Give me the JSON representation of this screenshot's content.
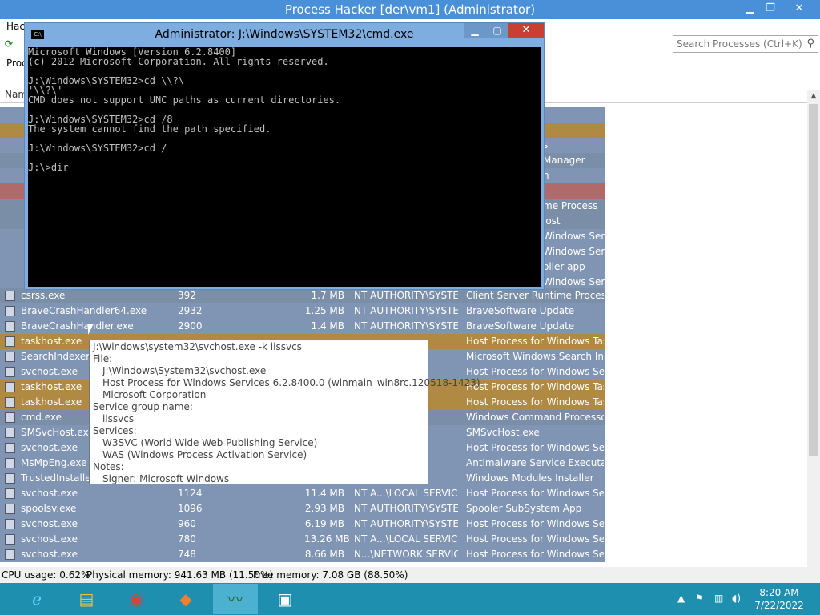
{
  "window": {
    "title": "Process Hacker [der\\vm1] (Administrator)",
    "menu_label": "Hac",
    "processes_tab": "Proc",
    "search_placeholder": "Search Processes (Ctrl+K)",
    "column_name": "Nam",
    "status": {
      "cpu": "CPU usage: 0.62%",
      "physical": "Physical memory: 941.63 MB (11.50%)",
      "free": "Free memory: 7.08 GB (88.50%)"
    }
  },
  "processes_hidden_desc": [
    {
      "row": 3,
      "desc": "s",
      "color": "svc"
    },
    {
      "row": 4,
      "desc": "Manager",
      "color": "sys"
    },
    {
      "row": 5,
      "desc": "n",
      "color": "svc"
    },
    {
      "row": 7,
      "desc": "me Process",
      "color": "sys"
    },
    {
      "row": 8,
      "desc": "lost",
      "color": "sys"
    },
    {
      "row": 9,
      "desc": "Windows Ser...",
      "color": "svc"
    },
    {
      "row": 10,
      "desc": "Windows Ser...",
      "color": "svc"
    },
    {
      "row": 11,
      "desc": "oller app",
      "color": "svc"
    },
    {
      "row": 12,
      "desc": "Windows Ser...",
      "color": "svc"
    }
  ],
  "processes": [
    {
      "name": "csrss.exe",
      "pid": "392",
      "mem": "1.7 MB",
      "user": "NT AUTHORITY\\SYSTEM",
      "desc": "Client Server Runtime Process",
      "color": "sys"
    },
    {
      "name": "BraveCrashHandler64.exe",
      "pid": "2932",
      "mem": "1.25 MB",
      "user": "NT AUTHORITY\\SYSTEM",
      "desc": "BraveSoftware Update",
      "color": "svc"
    },
    {
      "name": "BraveCrashHandler.exe",
      "pid": "2900",
      "mem": "1.4 MB",
      "user": "NT AUTHORITY\\SYSTEM",
      "desc": "BraveSoftware Update",
      "color": "svc"
    },
    {
      "name": "taskhost.exe",
      "pid": "",
      "mem": "",
      "user": "",
      "desc": "Host Process for Windows Tas...",
      "color": "own"
    },
    {
      "name": "SearchIndexer.exe",
      "pid": "",
      "mem": "",
      "user": "",
      "desc": "Microsoft Windows Search In...",
      "color": "svc"
    },
    {
      "name": "svchost.exe",
      "pid": "",
      "mem": "",
      "user": "RVICE",
      "desc": "Host Process for Windows Se...",
      "color": "svc"
    },
    {
      "name": "taskhost.exe",
      "pid": "",
      "mem": "",
      "user": "",
      "desc": "Host Process for Windows Tas...",
      "color": "own"
    },
    {
      "name": "taskhost.exe",
      "pid": "",
      "mem": "",
      "user": "",
      "desc": "Host Process for Windows Tas...",
      "color": "own"
    },
    {
      "name": "cmd.exe",
      "pid": "",
      "mem": "",
      "user": "YSTEM",
      "desc": "Windows Command Processor",
      "color": "sys"
    },
    {
      "name": "SMSvcHost.exe",
      "pid": "",
      "mem": "",
      "user": "YSTEM",
      "desc": "SMSvcHost.exe",
      "color": "svc"
    },
    {
      "name": "svchost.exe",
      "pid": "",
      "mem": "",
      "user": "YSTEM",
      "desc": "Host Process for Windows Se...",
      "color": "svc"
    },
    {
      "name": "MsMpEng.exe",
      "pid": "",
      "mem": "",
      "user": "YSTEM",
      "desc": "Antimalware Service Executable",
      "color": "svc"
    },
    {
      "name": "TrustedInstaller.",
      "pid": "",
      "mem": "",
      "user": "YSTEM",
      "desc": "Windows Modules Installer",
      "color": "svc"
    },
    {
      "name": "svchost.exe",
      "pid": "1124",
      "mem": "11.4 MB",
      "user": "NT A...\\LOCAL SERVICE",
      "desc": "Host Process for Windows Se...",
      "color": "svc"
    },
    {
      "name": "spoolsv.exe",
      "pid": "1096",
      "mem": "2.93 MB",
      "user": "NT AUTHORITY\\SYSTEM",
      "desc": "Spooler SubSystem App",
      "color": "svc"
    },
    {
      "name": "svchost.exe",
      "pid": "960",
      "mem": "6.19 MB",
      "user": "NT AUTHORITY\\SYSTEM",
      "desc": "Host Process for Windows Se...",
      "color": "svc"
    },
    {
      "name": "svchost.exe",
      "pid": "780",
      "mem": "13.26 MB",
      "user": "NT A...\\LOCAL SERVICE",
      "desc": "Host Process for Windows Se...",
      "color": "svc"
    },
    {
      "name": "svchost.exe",
      "pid": "748",
      "mem": "8.66 MB",
      "user": "N...\\NETWORK SERVICE",
      "desc": "Host Process for Windows Se...",
      "color": "svc"
    }
  ],
  "cmd": {
    "title": "Administrator: J:\\Windows\\SYSTEM32\\cmd.exe",
    "lines": [
      "Microsoft Windows [Version 6.2.8400]",
      "(c) 2012 Microsoft Corporation. All rights reserved.",
      "",
      "J:\\Windows\\SYSTEM32>cd \\\\?\\",
      "'\\\\?\\'",
      "CMD does not support UNC paths as current directories.",
      "",
      "J:\\Windows\\SYSTEM32>cd /8",
      "The system cannot find the path specified.",
      "",
      "J:\\Windows\\SYSTEM32>cd /",
      "",
      "J:\\>dir"
    ]
  },
  "tooltip": {
    "cmdline": "J:\\Windows\\system32\\svchost.exe -k iissvcs",
    "file_label": "File:",
    "file_path": "J:\\Windows\\System32\\svchost.exe",
    "file_desc": "Host Process for Windows Services 6.2.8400.0 (winmain_win8rc.120518-1423)",
    "company": "Microsoft Corporation",
    "group_label": "Service group name:",
    "group": "iissvcs",
    "services_label": "Services:",
    "service1": "W3SVC (World Wide Web Publishing Service)",
    "service2": "WAS (Windows Process Activation Service)",
    "notes_label": "Notes:",
    "signer": "Signer: Microsoft Windows"
  },
  "taskbar": {
    "time": "8:20 AM",
    "date": "7/22/2022"
  },
  "colors": {
    "service": "#8094b4",
    "own_process": "#b08a42",
    "system": "#7a8ea8",
    "titlebar": "#4a90d9",
    "taskbar": "#1f8fb0"
  }
}
